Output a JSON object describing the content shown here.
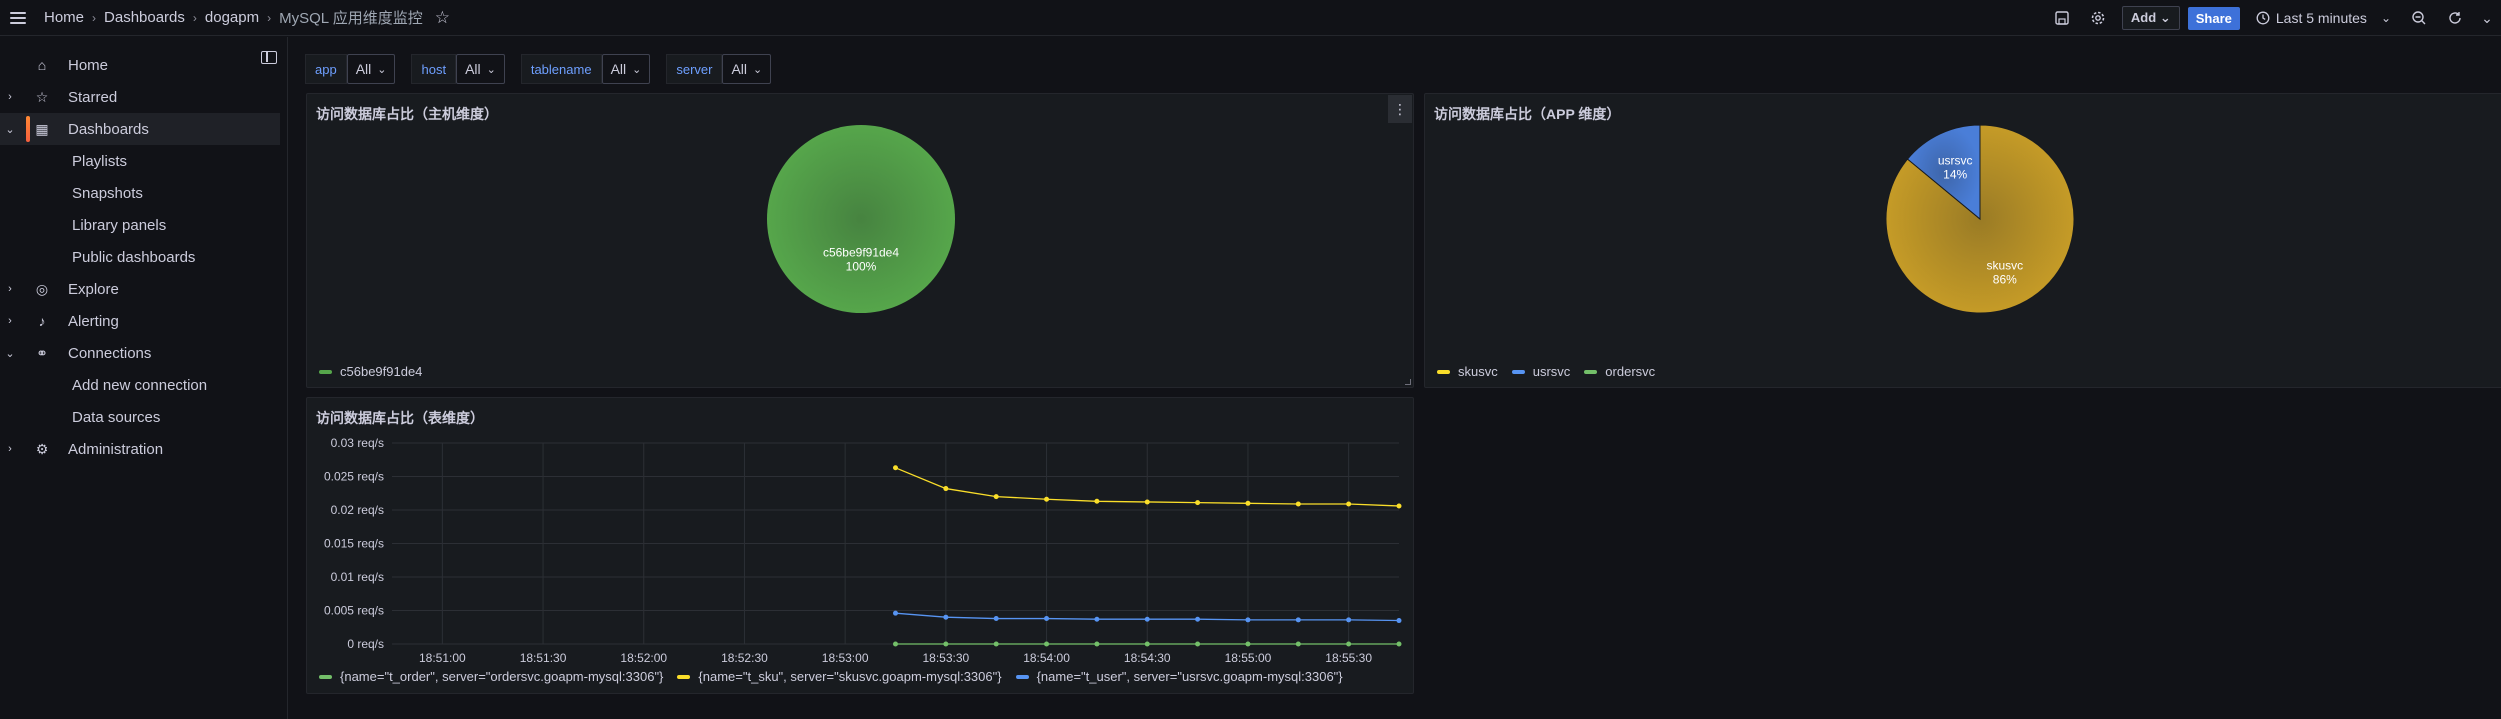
{
  "topbar": {
    "breadcrumbs": [
      "Home",
      "Dashboards",
      "dogapm",
      "MySQL 应用维度监控"
    ],
    "add_label": "Add",
    "share_label": "Share",
    "time_range": "Last 5 minutes"
  },
  "sidebar": {
    "items": [
      {
        "label": "Home",
        "icon": "home-icon",
        "chevron": ""
      },
      {
        "label": "Starred",
        "icon": "star-icon",
        "chevron": "›"
      },
      {
        "label": "Dashboards",
        "icon": "apps-icon",
        "chevron": "⌄",
        "active": true
      },
      {
        "label": "Playlists",
        "sub": true
      },
      {
        "label": "Snapshots",
        "sub": true
      },
      {
        "label": "Library panels",
        "sub": true
      },
      {
        "label": "Public dashboards",
        "sub": true
      },
      {
        "label": "Explore",
        "icon": "compass-icon",
        "chevron": "›"
      },
      {
        "label": "Alerting",
        "icon": "bell-icon",
        "chevron": "›"
      },
      {
        "label": "Connections",
        "icon": "plug-icon",
        "chevron": "⌄"
      },
      {
        "label": "Add new connection",
        "sub": true
      },
      {
        "label": "Data sources",
        "sub": true
      },
      {
        "label": "Administration",
        "icon": "cog-icon",
        "chevron": "›"
      }
    ]
  },
  "variables": [
    {
      "name": "app",
      "value": "All"
    },
    {
      "name": "host",
      "value": "All"
    },
    {
      "name": "tablename",
      "value": "All"
    },
    {
      "name": "server",
      "value": "All"
    }
  ],
  "panels": {
    "host_pie": {
      "title": "访问数据库占比（主机维度）",
      "legend": [
        {
          "label": "c56be9f91de4",
          "color": "#56a64b"
        }
      ]
    },
    "app_pie": {
      "title": "访问数据库占比（APP 维度）",
      "legend": [
        {
          "label": "skusvc",
          "color": "#fade2a"
        },
        {
          "label": "usrsvc",
          "color": "#5794f2"
        },
        {
          "label": "ordersvc",
          "color": "#73bf69"
        }
      ]
    },
    "table_ts": {
      "title": "访问数据库占比（表维度）"
    }
  },
  "chart_data": [
    {
      "type": "pie",
      "title": "访问数据库占比（主机维度）",
      "slices": [
        {
          "label": "c56be9f91de4",
          "value": 100,
          "percent_label": "100%",
          "color": "#56a64b"
        }
      ]
    },
    {
      "type": "pie",
      "title": "访问数据库占比（APP 维度）",
      "slices": [
        {
          "label": "skusvc",
          "value": 86,
          "percent_label": "86%",
          "color": "#c59b27"
        },
        {
          "label": "usrsvc",
          "value": 14,
          "percent_label": "14%",
          "color": "#4a7ed8"
        },
        {
          "label": "ordersvc",
          "value": 0,
          "percent_label": "",
          "color": "#73bf69"
        }
      ]
    },
    {
      "type": "line",
      "title": "访问数据库占比（表维度）",
      "x": [
        "18:53:15",
        "18:53:30",
        "18:53:45",
        "18:54:00",
        "18:54:15",
        "18:54:30",
        "18:54:45",
        "18:55:00",
        "18:55:15",
        "18:55:30",
        "18:55:45"
      ],
      "xticks": [
        "18:51:00",
        "18:51:30",
        "18:52:00",
        "18:52:30",
        "18:53:00",
        "18:53:30",
        "18:54:00",
        "18:54:30",
        "18:55:00",
        "18:55:30"
      ],
      "xrange": [
        "18:50:45",
        "18:55:45"
      ],
      "yticks": [
        "0 req/s",
        "0.005 req/s",
        "0.01 req/s",
        "0.015 req/s",
        "0.02 req/s",
        "0.025 req/s",
        "0.03 req/s"
      ],
      "ylim": [
        0,
        0.03
      ],
      "grid": true,
      "legend_position": "bottom",
      "series": [
        {
          "name": "{name=\"t_order\", server=\"ordersvc.goapm-mysql:3306\"}",
          "color": "#73bf69",
          "values": [
            0,
            0,
            0,
            0,
            0,
            0,
            0,
            0,
            0,
            0,
            0
          ]
        },
        {
          "name": "{name=\"t_sku\", server=\"skusvc.goapm-mysql:3306\"}",
          "color": "#fade2a",
          "values": [
            0.0263,
            0.0232,
            0.022,
            0.0216,
            0.0213,
            0.0212,
            0.0211,
            0.021,
            0.0209,
            0.0209,
            0.0206
          ]
        },
        {
          "name": "{name=\"t_user\", server=\"usrsvc.goapm-mysql:3306\"}",
          "color": "#5794f2",
          "values": [
            0.0046,
            0.004,
            0.0038,
            0.0038,
            0.0037,
            0.0037,
            0.0037,
            0.0036,
            0.0036,
            0.0036,
            0.0035
          ]
        }
      ]
    }
  ]
}
